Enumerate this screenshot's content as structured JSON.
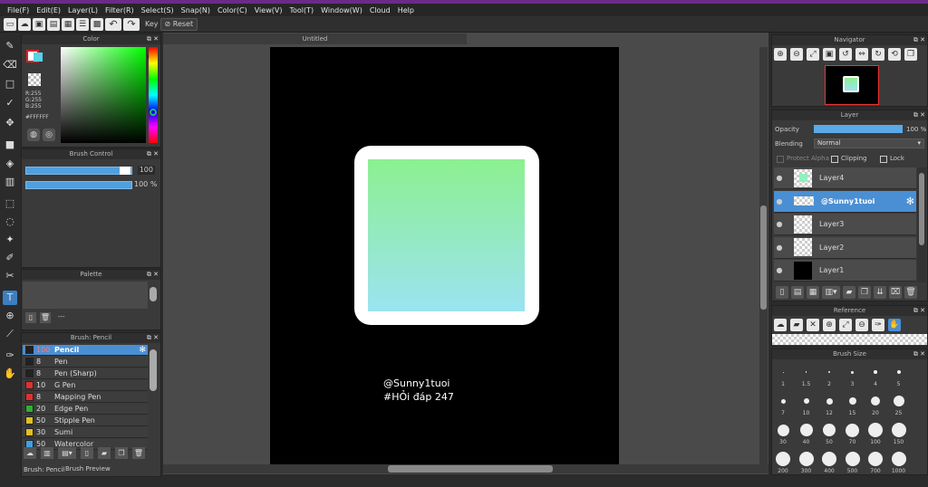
{
  "menu": [
    "File(F)",
    "Edit(E)",
    "Layer(L)",
    "Filter(R)",
    "Select(S)",
    "Snap(N)",
    "Color(C)",
    "View(V)",
    "Tool(T)",
    "Window(W)",
    "Cloud",
    "Help"
  ],
  "toolbar": {
    "key_label": "Key",
    "reset_label": "Reset"
  },
  "panels": {
    "color": "Color",
    "brush_control": "Brush Control",
    "palette": "Palette",
    "brush_list": "Brush: Pencil",
    "navigator": "Navigator",
    "layer": "Layer",
    "reference": "Reference",
    "brush_size": "Brush Size"
  },
  "color": {
    "r": "R:255",
    "g": "G:255",
    "b": "B:255",
    "hex": "#FFFFFF"
  },
  "brush_control": {
    "size": "100",
    "opacity": "100 %"
  },
  "palette": {
    "label": "---"
  },
  "brushes": [
    {
      "num": "100",
      "name": "Pencil",
      "color": "#222222"
    },
    {
      "num": "8",
      "name": "Pen",
      "color": "#222222"
    },
    {
      "num": "8",
      "name": "Pen (Sharp)",
      "color": "#222222"
    },
    {
      "num": "10",
      "name": "G Pen",
      "color": "#e03030"
    },
    {
      "num": "8",
      "name": "Mapping Pen",
      "color": "#e03030"
    },
    {
      "num": "20",
      "name": "Edge Pen",
      "color": "#30b030"
    },
    {
      "num": "50",
      "name": "Stipple Pen",
      "color": "#e0c020"
    },
    {
      "num": "30",
      "name": "Sumi",
      "color": "#e0c020"
    },
    {
      "num": "50",
      "name": "Watercolor",
      "color": "#40a0e0"
    }
  ],
  "brush_tabs": [
    "Brush: Pencil",
    "Brush Preview"
  ],
  "canvas": {
    "tab": "Untitled",
    "line1": "@Sunny1tuoi",
    "line2": "#HỎi đáp 247"
  },
  "layer": {
    "opacity_label": "Opacity",
    "opacity_value": "100 %",
    "opacity_fraction": 1.0,
    "blending_label": "Blending",
    "blending_value": "Normal",
    "protect_alpha": "Protect Alpha",
    "clipping": "Clipping",
    "lock": "Lock"
  },
  "layers": [
    "Layer4",
    "@Sunny1tuoi",
    "Layer3",
    "Layer2",
    "Layer1"
  ],
  "brush_sizes": [
    "1",
    "1.5",
    "2",
    "3",
    "4",
    "5",
    "7",
    "10",
    "12",
    "15",
    "20",
    "25",
    "30",
    "40",
    "50",
    "70",
    "100",
    "150",
    "200",
    "300",
    "400",
    "500",
    "700",
    "1000"
  ]
}
